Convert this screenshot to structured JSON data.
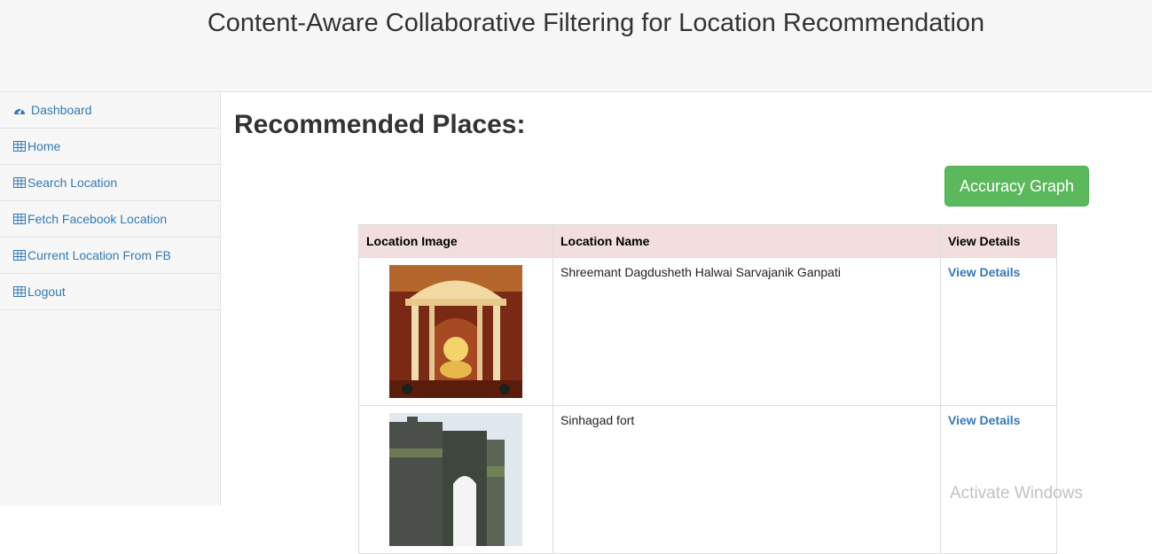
{
  "header": {
    "title": "Content-Aware Collaborative Filtering for Location Recommendation"
  },
  "sidebar": {
    "items": [
      {
        "label": "Dashboard",
        "icon": "dashboard-icon"
      },
      {
        "label": "Home",
        "icon": "table-icon"
      },
      {
        "label": "Search Location",
        "icon": "table-icon"
      },
      {
        "label": "Fetch Facebook Location",
        "icon": "table-icon"
      },
      {
        "label": "Current Location From FB",
        "icon": "table-icon"
      },
      {
        "label": "Logout",
        "icon": "table-icon"
      }
    ]
  },
  "main": {
    "heading": "Recommended Places:",
    "accuracy_button": "Accuracy Graph",
    "table": {
      "headers": [
        "Location Image",
        "Location Name",
        "View Details"
      ],
      "rows": [
        {
          "name": "Shreemant Dagdusheth Halwai Sarvajanik Ganpati",
          "link": "View Details"
        },
        {
          "name": "Sinhagad fort",
          "link": "View Details"
        }
      ]
    }
  },
  "watermark": "Activate Windows",
  "colors": {
    "accent": "#337ab7",
    "success": "#5cb85c",
    "table_header": "#f2dede",
    "panel": "#f7f7f7"
  }
}
